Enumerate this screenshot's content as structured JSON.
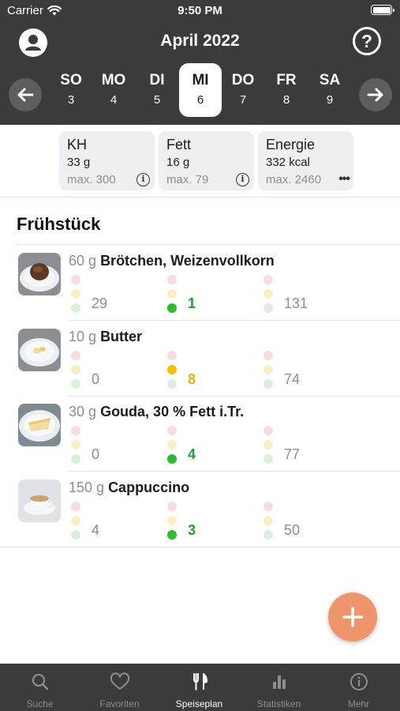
{
  "status_bar": {
    "carrier": "Carrier",
    "time": "9:50 PM"
  },
  "header": {
    "title": "April 2022",
    "help_label": "?",
    "days": [
      {
        "name": "SO",
        "num": "3"
      },
      {
        "name": "MO",
        "num": "4"
      },
      {
        "name": "DI",
        "num": "5"
      },
      {
        "name": "MI",
        "num": "6",
        "selected": true
      },
      {
        "name": "DO",
        "num": "7"
      },
      {
        "name": "FR",
        "num": "8"
      },
      {
        "name": "SA",
        "num": "9"
      }
    ]
  },
  "summary": [
    {
      "label": "KH",
      "value": "33 g",
      "max": "max. 300",
      "icon": "info-icon"
    },
    {
      "label": "Fett",
      "value": "16 g",
      "max": "max. 79",
      "icon": "info-icon"
    },
    {
      "label": "Energie",
      "value": "332 kcal",
      "max": "max. 2460",
      "icon": "more-icon"
    }
  ],
  "meal": {
    "title": "Frühstück",
    "items": [
      {
        "amount": "60 g",
        "name": "Brötchen, Weizenvollkorn",
        "kh": "29",
        "fett": "1",
        "kcal": "131",
        "fett_level": "green"
      },
      {
        "amount": "10 g",
        "name": "Butter",
        "kh": "0",
        "fett": "8",
        "kcal": "74",
        "fett_level": "yellow"
      },
      {
        "amount": "30 g",
        "name": "Gouda, 30 % Fett i.Tr.",
        "kh": "0",
        "fett": "4",
        "kcal": "77",
        "fett_level": "green"
      },
      {
        "amount": "150 g",
        "name": "Cappuccino",
        "kh": "4",
        "fett": "3",
        "kcal": "50",
        "fett_level": "green"
      }
    ]
  },
  "fab": {
    "icon": "plus-icon"
  },
  "tabs": [
    {
      "label": "Suche",
      "icon": "search-icon"
    },
    {
      "label": "Favoriten",
      "icon": "heart-icon"
    },
    {
      "label": "Speiseplan",
      "icon": "fork-knife-icon",
      "active": true
    },
    {
      "label": "Statistiken",
      "icon": "bar-chart-icon"
    },
    {
      "label": "Mehr",
      "icon": "info-icon"
    }
  ],
  "colors": {
    "header_bg": "#3b3b3b",
    "accent_orange": "#f0956b",
    "light_green": "#2bbd2b",
    "light_yellow": "#f3c200"
  }
}
